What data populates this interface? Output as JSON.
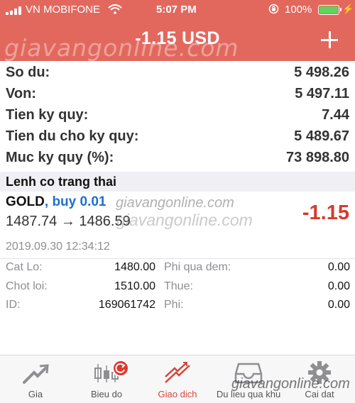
{
  "status": {
    "carrier": "VN MOBIFONE",
    "time": "5:07 PM",
    "battery": "100%",
    "battery_fill_fraction": 1.0
  },
  "header": {
    "title": "-1.15 USD",
    "watermark": "giavangonline.com",
    "add_icon": "plus-icon"
  },
  "summary": [
    {
      "label": "So du:",
      "value": "5 498.26"
    },
    {
      "label": "Von:",
      "value": "5 497.11"
    },
    {
      "label": "Tien ky quy:",
      "value": "7.44"
    },
    {
      "label": "Tien du cho ky quy:",
      "value": "5 489.67"
    },
    {
      "label": "Muc ky quy (%):",
      "value": "73 898.80"
    }
  ],
  "section_title": "Lenh co trang thai",
  "position": {
    "symbol": "GOLD",
    "side": ", buy 0.01",
    "prices": "1487.74 → 1486.59",
    "profit": "-1.15",
    "datetime": "2019.09.30 12:34:12",
    "watermark1": "giavangonline.com",
    "watermark2": "giavangonline.com",
    "details": [
      {
        "label": "Cat Lo:",
        "value": "1480.00"
      },
      {
        "label": "Chot loi:",
        "value": "1510.00"
      },
      {
        "label": "ID:",
        "value": "169061742"
      },
      {
        "label": "Phi qua dem:",
        "value": "0.00"
      },
      {
        "label": "Thue:",
        "value": "0.00"
      },
      {
        "label": "Phi:",
        "value": "0.00"
      }
    ]
  },
  "tabs": [
    {
      "label": "Gia",
      "icon": "chart-arrow-icon"
    },
    {
      "label": "Bieu do",
      "icon": "candlestick-icon"
    },
    {
      "label": "Giao dich",
      "icon": "trend-icon"
    },
    {
      "label": "Du lieu qua khu",
      "icon": "inbox-icon"
    },
    {
      "label": "Cai dat",
      "icon": "gear-icon"
    }
  ],
  "active_tab": "Giao dich",
  "bottom_watermark": "giavangonline.com",
  "colors": {
    "header": "#e2685e",
    "profit_negative": "#d63a2f",
    "buy": "#1e6fd0",
    "active_tab": "#d6473b"
  }
}
